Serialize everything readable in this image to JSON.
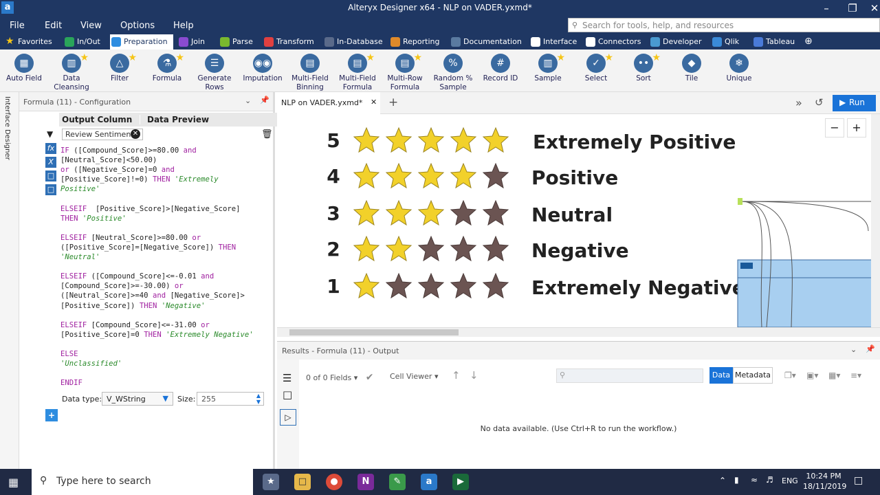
{
  "window": {
    "title": "Alteryx Designer x64 - NLP on VADER.yxmd*"
  },
  "menu": {
    "items": [
      "File",
      "Edit",
      "View",
      "Options",
      "Help"
    ],
    "search_placeholder": "Search for tools, help, and resources"
  },
  "categories": [
    "Favorites",
    "In/Out",
    "Preparation",
    "Join",
    "Parse",
    "Transform",
    "In-Database",
    "Reporting",
    "Documentation",
    "Interface",
    "Connectors",
    "Developer",
    "Qlik",
    "Tableau"
  ],
  "category_colors": [
    "#f5c518",
    "#2aa55a",
    "#2e8de0",
    "#8a4bd0",
    "#7ab82e",
    "#e04040",
    "#5a6a8a",
    "#e08a2a",
    "#5a7aa0",
    "#ffffff",
    "#ffffff",
    "#4a9ad0",
    "#3a8ad8",
    "#4a7ad8"
  ],
  "tools": [
    {
      "label1": "Auto Field",
      "label2": "",
      "icon": "auto-field-icon",
      "star": false
    },
    {
      "label1": "Data",
      "label2": "Cleansing",
      "icon": "data-cleansing-icon",
      "star": true
    },
    {
      "label1": "Filter",
      "label2": "",
      "icon": "filter-icon",
      "star": true
    },
    {
      "label1": "Formula",
      "label2": "",
      "icon": "formula-icon",
      "star": true
    },
    {
      "label1": "Generate",
      "label2": "Rows",
      "icon": "generate-rows-icon",
      "star": false
    },
    {
      "label1": "Imputation",
      "label2": "",
      "icon": "imputation-icon",
      "star": false
    },
    {
      "label1": "Multi-Field",
      "label2": "Binning",
      "icon": "multi-field-binning-icon",
      "star": false
    },
    {
      "label1": "Multi-Field",
      "label2": "Formula",
      "icon": "multi-field-formula-icon",
      "star": true
    },
    {
      "label1": "Multi-Row",
      "label2": "Formula",
      "icon": "multi-row-formula-icon",
      "star": true
    },
    {
      "label1": "Random %",
      "label2": "Sample",
      "icon": "random-sample-icon",
      "star": false
    },
    {
      "label1": "Record ID",
      "label2": "",
      "icon": "record-id-icon",
      "star": false
    },
    {
      "label1": "Sample",
      "label2": "",
      "icon": "sample-icon",
      "star": true
    },
    {
      "label1": "Select",
      "label2": "",
      "icon": "select-icon",
      "star": true
    },
    {
      "label1": "Sort",
      "label2": "",
      "icon": "sort-icon",
      "star": true
    },
    {
      "label1": "Tile",
      "label2": "",
      "icon": "tile-icon",
      "star": false
    },
    {
      "label1": "Unique",
      "label2": "",
      "icon": "unique-icon",
      "star": false
    }
  ],
  "leftstrip": {
    "label": "Interface Designer"
  },
  "config": {
    "title": "Formula (11) - Configuration",
    "col_output": "Output Column",
    "col_preview": "Data Preview",
    "output_field": "Review Sentiment",
    "datatype_label": "Data type:",
    "datatype_value": "V_WString",
    "size_label": "Size:",
    "size_value": "255"
  },
  "canvas": {
    "tab": "NLP on VADER.yxmd*",
    "run_label": "Run",
    "ratings": [
      {
        "num": "5",
        "filled": 5,
        "label": "Extremely Positive"
      },
      {
        "num": "4",
        "filled": 4,
        "label": "Positive"
      },
      {
        "num": "3",
        "filled": 3,
        "label": "Neutral"
      },
      {
        "num": "2",
        "filled": 2,
        "label": "Negative"
      },
      {
        "num": "1",
        "filled": 1,
        "label": "Extremely Negative"
      }
    ]
  },
  "results": {
    "title": "Results - Formula (11) - Output",
    "fields": "0 of 0 Fields",
    "viewer": "Cell Viewer",
    "tab_data": "Data",
    "tab_metadata": "Metadata",
    "empty_msg": "No data available. (Use Ctrl+R to run the workflow.)"
  },
  "taskbar": {
    "search": "Type here to search",
    "time": "10:24 PM",
    "date": "18/11/2019",
    "lang": "ENG"
  },
  "colors": {
    "star_filled": "#f2d12a",
    "star_empty": "#6b5452",
    "titlebar": "#1f3763",
    "accent": "#1a73d8"
  }
}
